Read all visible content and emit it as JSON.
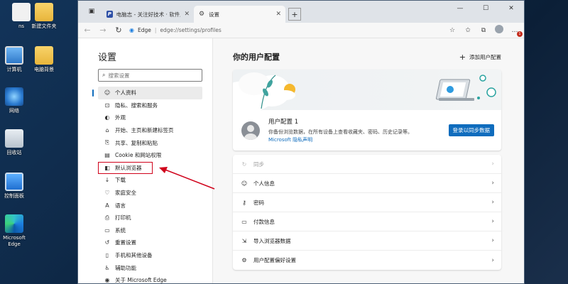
{
  "desktop": {
    "icons": [
      {
        "label": "ns"
      },
      {
        "label": "新建文件夹"
      },
      {
        "label": "计算机"
      },
      {
        "label": "电脑背景"
      },
      {
        "label": "网络"
      },
      {
        "label": "回收站"
      },
      {
        "label": "控制面板"
      },
      {
        "label": "Microsoft Edge"
      }
    ]
  },
  "browser": {
    "tabs": [
      {
        "label": "电脑志 - 关注好技术 · 软件应用",
        "icon": "site-favicon"
      },
      {
        "label": "设置",
        "icon": "gear-icon"
      }
    ],
    "new_tab": "+",
    "address": {
      "brand": "Edge",
      "separator": "|",
      "url": "edge://settings/profiles"
    },
    "notification_count": "1"
  },
  "sidebar": {
    "title": "设置",
    "search_placeholder": "搜索设置",
    "items": [
      {
        "label": "个人资料",
        "icon": "person-icon"
      },
      {
        "label": "隐私、搜索和服务",
        "icon": "lock-icon"
      },
      {
        "label": "外观",
        "icon": "appearance-icon"
      },
      {
        "label": "开始、主页和新建标签页",
        "icon": "home-icon"
      },
      {
        "label": "共享、复制和粘贴",
        "icon": "share-icon"
      },
      {
        "label": "Cookie 和网站权限",
        "icon": "site-permissions-icon"
      },
      {
        "label": "默认浏览器",
        "icon": "browser-icon"
      },
      {
        "label": "下载",
        "icon": "download-icon"
      },
      {
        "label": "家庭安全",
        "icon": "family-icon"
      },
      {
        "label": "语言",
        "icon": "language-icon"
      },
      {
        "label": "打印机",
        "icon": "printer-icon"
      },
      {
        "label": "系统",
        "icon": "system-icon"
      },
      {
        "label": "重置设置",
        "icon": "reset-icon"
      },
      {
        "label": "手机和其他设备",
        "icon": "phone-icon"
      },
      {
        "label": "辅助功能",
        "icon": "accessibility-icon"
      },
      {
        "label": "关于 Microsoft Edge",
        "icon": "edge-icon"
      }
    ]
  },
  "main": {
    "title": "你的用户配置",
    "add_profile": "添加用户配置",
    "profile": {
      "name": "用户配置 1",
      "desc": "你备份浏览数据，在所有设备上查看收藏夹、密码、历史记录等。",
      "link": "Microsoft 隐私声明",
      "sync_button": "登录以同步数据"
    },
    "rows": [
      {
        "label": "同步",
        "icon": "sync-icon",
        "disabled": true
      },
      {
        "label": "个人信息",
        "icon": "personal-info-icon"
      },
      {
        "label": "密码",
        "icon": "key-icon"
      },
      {
        "label": "付款信息",
        "icon": "card-icon"
      },
      {
        "label": "导入浏览器数据",
        "icon": "import-icon"
      },
      {
        "label": "用户配置偏好设置",
        "icon": "profile-prefs-icon"
      }
    ]
  },
  "colors": {
    "accent": "#0f6cbd",
    "annotation": "#d0021b"
  }
}
